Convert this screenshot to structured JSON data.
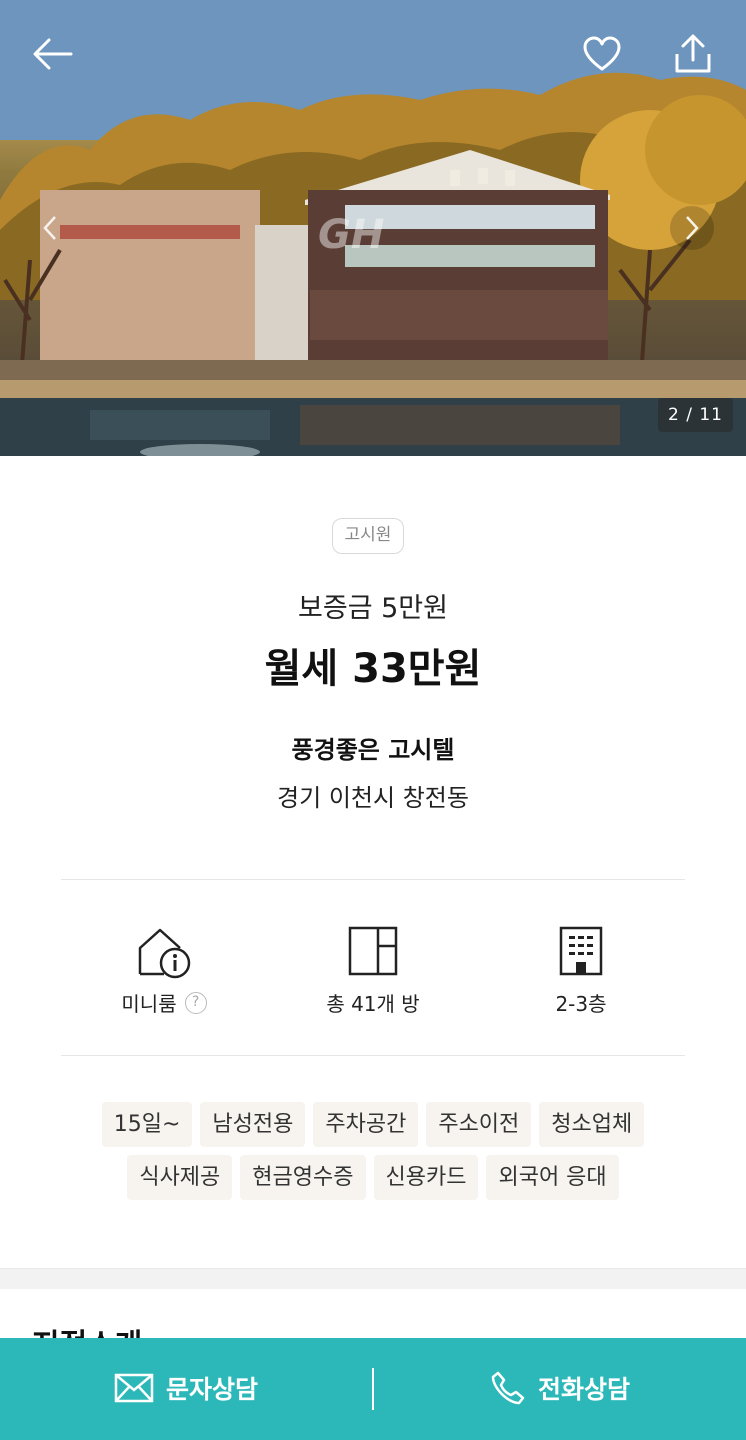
{
  "hero": {
    "counter": "2 / 11",
    "watermark": "GH",
    "icons": {
      "back": "back-arrow-icon",
      "favorite": "heart-icon",
      "share": "share-icon",
      "prev": "chevron-left-icon",
      "next": "chevron-right-icon"
    }
  },
  "listing": {
    "category": "고시원",
    "deposit": "보증금 5만원",
    "monthly_rent": "월세 33만원",
    "title": "풍경좋은 고시텔",
    "address": "경기 이천시 창전동"
  },
  "specs": {
    "room_type": "미니룸",
    "help_glyph": "?",
    "total_rooms": "총 41개 방",
    "floors": "2-3층"
  },
  "tags": [
    "15일~",
    "남성전용",
    "주차공간",
    "주소이전",
    "청소업체",
    "식사제공",
    "현금영수증",
    "신용카드",
    "외국어 응대"
  ],
  "section": {
    "title": "지점소개"
  },
  "bottom_bar": {
    "sms_label": "문자상담",
    "call_label": "전화상담",
    "color": "#2cb8b9"
  }
}
